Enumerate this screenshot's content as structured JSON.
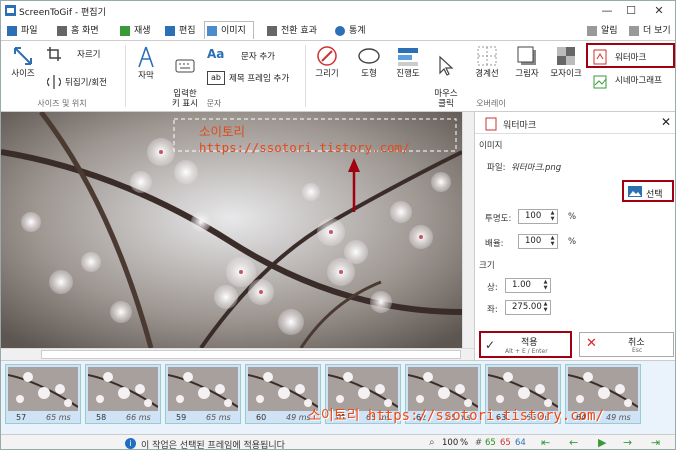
{
  "window": {
    "title": "ScreenToGif - 편집기"
  },
  "menu": {
    "tabs": [
      "파일",
      "홈 화면",
      "재생",
      "편집",
      "이미지",
      "전환 효과",
      "통계"
    ],
    "right": {
      "alerts": "알림",
      "more": "더 보기"
    }
  },
  "ribbon": {
    "size": "사이즈",
    "crop": "자르기",
    "flip": "뒤집기/회전",
    "group_size": "사이즈 및 위치",
    "caption": "자막",
    "keystroke": "입력한\n키 표시",
    "text_add": "문자 추가",
    "title_frame": "제목 프레임 추가",
    "group_text": "문자",
    "draw": "그리기",
    "shapes": "도형",
    "progress": "진행도",
    "mouse_click": "마우스\n클릭",
    "border": "경계선",
    "shadow": "그림자",
    "mosaic": "모자이크",
    "watermark": "워터마크",
    "cinemagraph": "시네마그래프",
    "group_overlay": "오버레이"
  },
  "panel": {
    "title": "워터마크",
    "section_image": "이미지",
    "file_label": "파일:",
    "file_value": "워터마크.png",
    "select_button": "선택",
    "opacity_label": "투명도:",
    "opacity_value": "100",
    "opacity_unit": "%",
    "scale_label": "배율:",
    "scale_value": "100",
    "scale_unit": "%",
    "section_size": "크기",
    "top_label": "상:",
    "top_value": "1.00",
    "left_label": "좌:",
    "left_value": "275.00",
    "apply_label": "적용",
    "apply_shortcut": "Alt + E / Enter",
    "cancel_label": "취소",
    "cancel_shortcut": "Esc"
  },
  "canvas": {
    "watermark_text": "소이토리 https://ssotori.tistory.com/"
  },
  "frames": [
    {
      "num": "57",
      "delay": "65 ms"
    },
    {
      "num": "58",
      "delay": "66 ms"
    },
    {
      "num": "59",
      "delay": "65 ms"
    },
    {
      "num": "60",
      "delay": "49 ms"
    },
    {
      "num": "61",
      "delay": "65 ms"
    },
    {
      "num": "62",
      "delay": "65 ms"
    },
    {
      "num": "63",
      "delay": "66 ms"
    },
    {
      "num": "64",
      "delay": "49 ms"
    }
  ],
  "strip_watermark": "소이토리 https://ssotori.tistory.com/",
  "status": {
    "message": "이 작업은 선택된 프레임에 적용됩니다",
    "zoom": "100",
    "zoom_unit": "%",
    "total": "65",
    "selected": "65",
    "current": "64"
  },
  "colors": {
    "highlight": "#a00010",
    "accent": "#1e6fc2",
    "watermark": "#e04b1a"
  }
}
